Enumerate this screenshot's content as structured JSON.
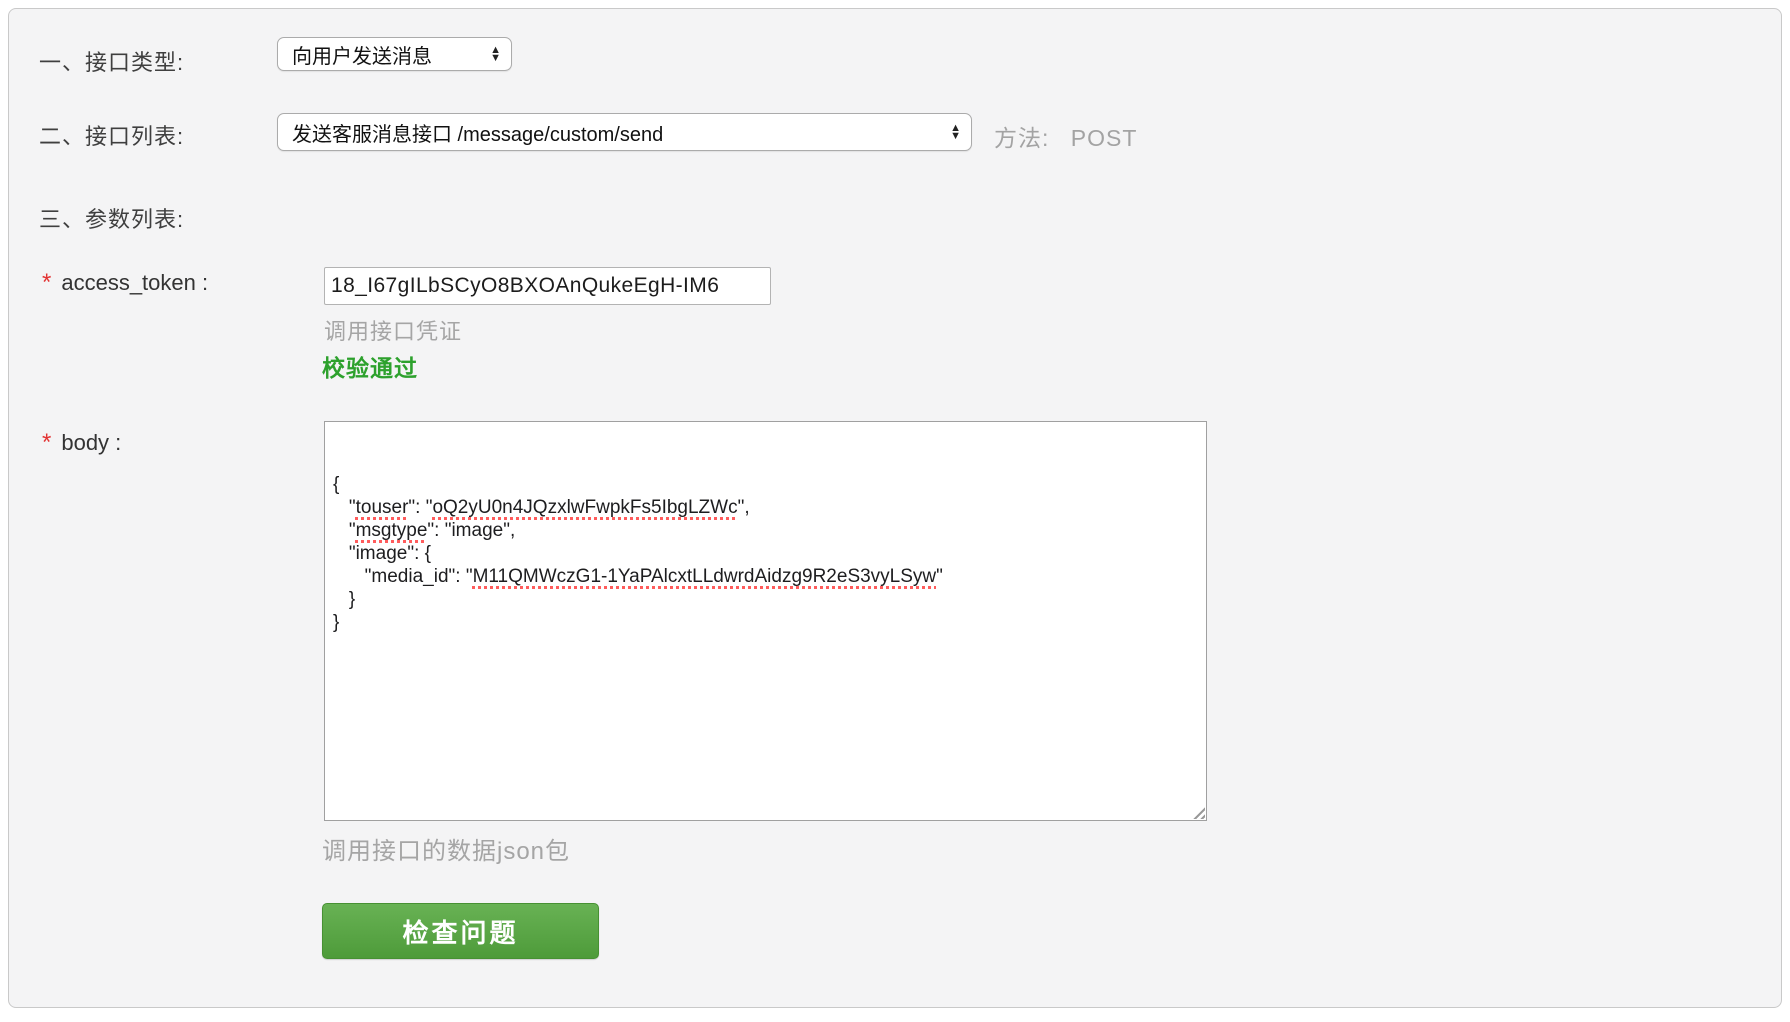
{
  "rows": {
    "type": {
      "label": "一、接口类型:",
      "select_value": "向用户发送消息",
      "stepper_up": "▲",
      "stepper_down": "▼"
    },
    "list": {
      "label": "二、接口列表:",
      "select_value": "发送客服消息接口 /message/custom/send",
      "method_label": "方法:",
      "method_value": "POST"
    },
    "params": {
      "label": "三、参数列表:"
    }
  },
  "access_token": {
    "required_mark": "*",
    "label": "access_token :",
    "value": "18_I67gILbSCyO8BXOAnQukeEgH-IM6",
    "hint": "调用接口凭证",
    "status": "校验通过"
  },
  "body_param": {
    "required_mark": "*",
    "label": "body :",
    "hint": "调用接口的数据json包",
    "json_lines": [
      [
        {
          "t": "{"
        }
      ],
      [
        {
          "t": "   \""
        },
        {
          "t": "touser",
          "m": true
        },
        {
          "t": "\": \""
        },
        {
          "t": "oQ2yU0n4JQzxlwFwpkFs5IbgLZWc",
          "m": true
        },
        {
          "t": "\","
        }
      ],
      [
        {
          "t": "   \""
        },
        {
          "t": "msgtype",
          "m": true
        },
        {
          "t": "\": \"image\","
        }
      ],
      [
        {
          "t": "   \"image\": {"
        }
      ],
      [
        {
          "t": "      \"media_id\": \""
        },
        {
          "t": "M11QMWczG1-1YaPAlcxtLLdwrdAidzg9R2eS3vyLSyw",
          "m": true
        },
        {
          "t": "\""
        }
      ],
      [
        {
          "t": "   }"
        }
      ],
      [
        {
          "t": "}"
        }
      ]
    ]
  },
  "submit": {
    "label": "检查问题"
  },
  "colors": {
    "success_green": "#2da12d",
    "required_red": "#e23333",
    "button_green_top": "#68b254",
    "button_green_bottom": "#4e9b3a",
    "spellcheck_red": "#ff5c5c",
    "muted_gray": "#a5a5a5"
  }
}
